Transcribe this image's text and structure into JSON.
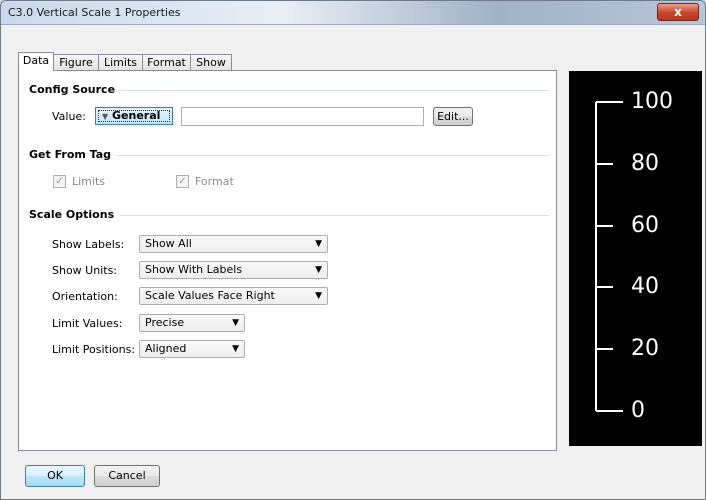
{
  "window": {
    "title": "C3.0 Vertical Scale 1 Properties",
    "close_glyph": "x"
  },
  "tabs": [
    {
      "label": "Data",
      "active": true
    },
    {
      "label": "Figure",
      "active": false
    },
    {
      "label": "Limits",
      "active": false
    },
    {
      "label": "Format",
      "active": false
    },
    {
      "label": "Show",
      "active": false
    }
  ],
  "config_source": {
    "title": "Config Source",
    "value_label": "Value:",
    "dropdown_value": "General",
    "text_value": "",
    "edit_label": "Edit..."
  },
  "get_from_tag": {
    "title": "Get From Tag",
    "limits_label": "Limits",
    "limits_checked": true,
    "format_label": "Format",
    "format_checked": true
  },
  "scale_options": {
    "title": "Scale Options",
    "rows": [
      {
        "label": "Show Labels:",
        "value": "Show All"
      },
      {
        "label": "Show Units:",
        "value": "Show With Labels"
      },
      {
        "label": "Orientation:",
        "value": "Scale Values Face Right"
      },
      {
        "label": "Limit Values:",
        "value": "Precise"
      },
      {
        "label": "Limit Positions:",
        "value": "Aligned"
      }
    ]
  },
  "preview": {
    "labels": [
      "100",
      "80",
      "60",
      "40",
      "20",
      "0"
    ],
    "background": "#000000",
    "foreground": "#ffffff"
  },
  "footer": {
    "ok_label": "OK",
    "cancel_label": "Cancel"
  }
}
